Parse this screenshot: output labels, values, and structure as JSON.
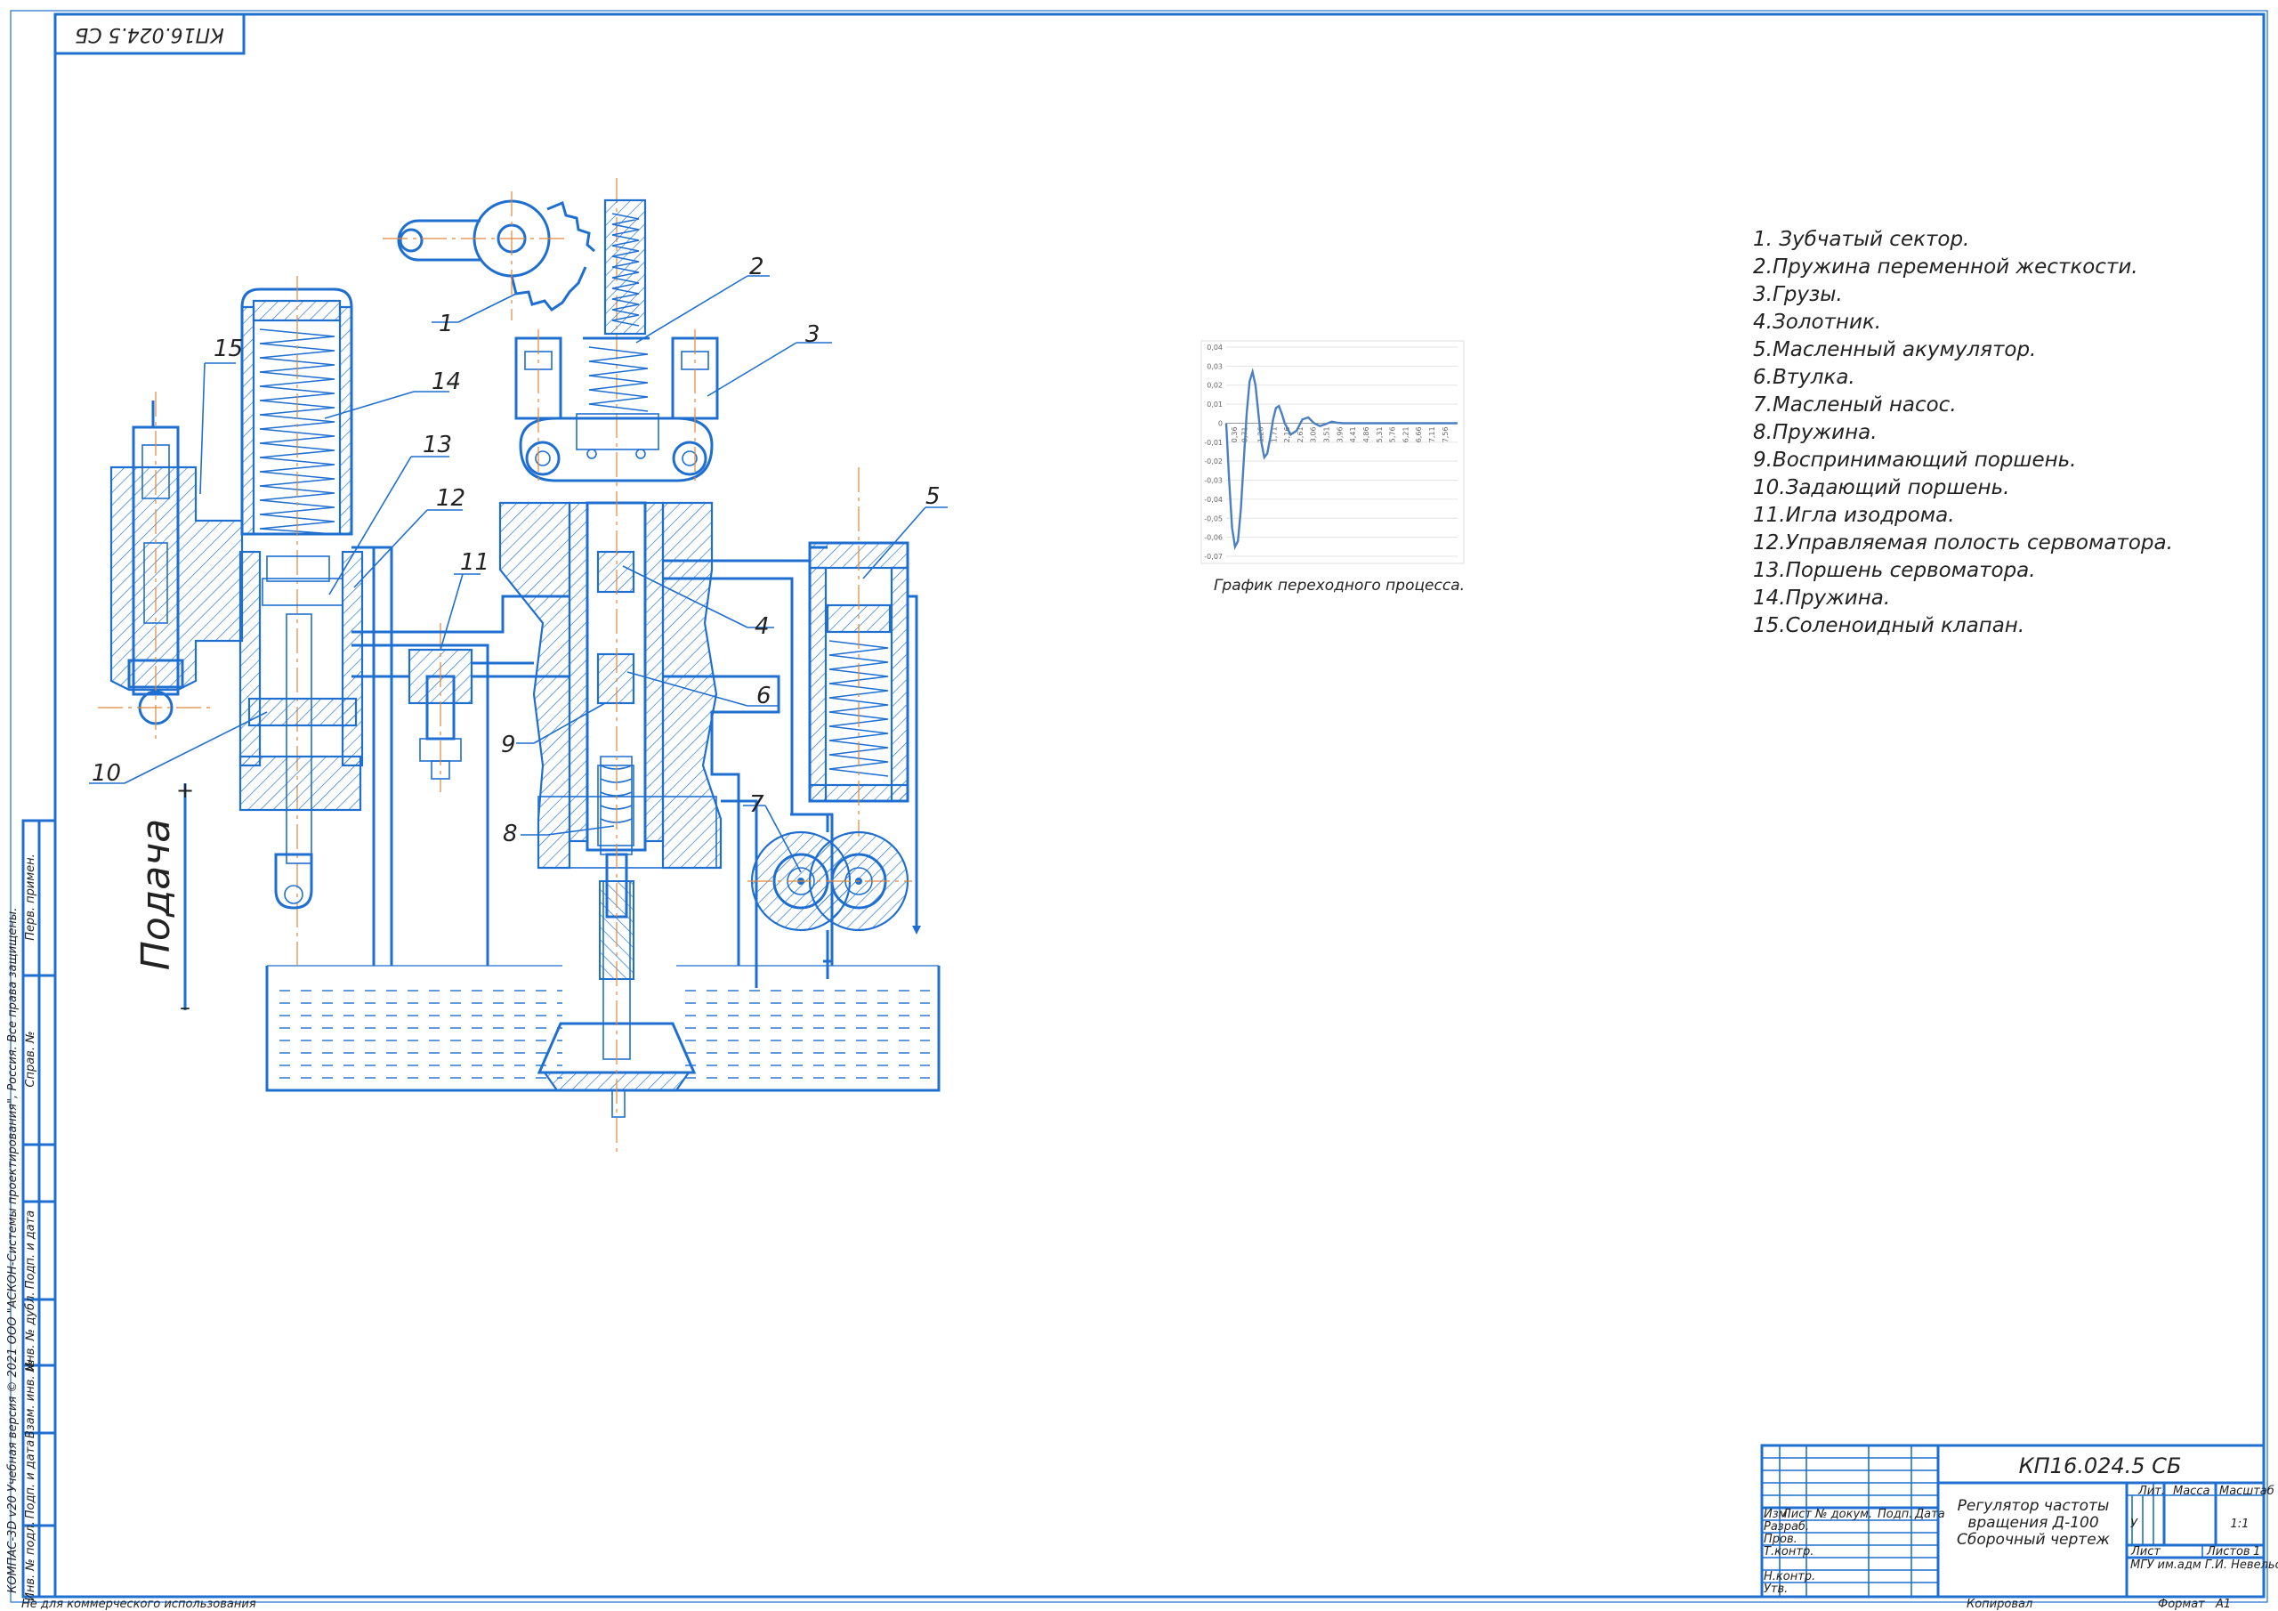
{
  "sheet": {
    "stamp_code_rotated": "КП16.024.5 СБ",
    "footer_left": "Не для коммерческого использования",
    "footer_copied": "Копировал",
    "footer_format_label": "Формат",
    "footer_format_value": "А1",
    "license_text": "КОМПАС-3D v20 Учебная версия © 2021 ООО \"АСКОН-Системы проектирования\", Россия. Все права защищены.",
    "side_labels": [
      "Перв. примен.",
      "Справ. №",
      "Подп. и дата",
      "Инв. № дубл.",
      "Взам. инв. №",
      "Подп. и дата",
      "Инв. № подл."
    ]
  },
  "drawing": {
    "supply_label": "Подача",
    "plus_sign": "+",
    "minus_sign": "–",
    "callouts": [
      "1",
      "2",
      "3",
      "4",
      "5",
      "6",
      "7",
      "8",
      "9",
      "10",
      "11",
      "12",
      "13",
      "14",
      "15"
    ]
  },
  "parts_list": [
    "1. Зубчатый сектор.",
    "2.Пружина переменной жесткости.",
    "3.Грузы.",
    "4.Золотник.",
    "5.Масленный акумулятор.",
    "6.Втулка.",
    "7.Масленый насос.",
    "8.Пружина.",
    "9.Воспринимающий поршень.",
    "10.Задающий поршень.",
    "11.Игла изодрома.",
    "12.Управляемая полость сервоматора.",
    "13.Поршень сервоматора.",
    "14.Пружина.",
    "15.Соленоидный клапан."
  ],
  "chart_data": {
    "type": "line",
    "title": "График переходного процесса.",
    "y_ticks": [
      "0,04",
      "0,03",
      "0,02",
      "0,01",
      "0",
      "-0,01",
      "-0,02",
      "-0,03",
      "-0,04",
      "-0,05",
      "-0,06",
      "-0,07"
    ],
    "x_ticks": [
      "0,36",
      "0,71",
      "1,26",
      "1,71",
      "2,16",
      "2,61",
      "3,06",
      "3,51",
      "3,96",
      "4,41",
      "4,86",
      "5,31",
      "5,76",
      "6,21",
      "6,66",
      "7,11",
      "7,56"
    ],
    "ylim": [
      -0.07,
      0.04
    ],
    "xlim": [
      0,
      7.9
    ],
    "grid": true,
    "series": [
      {
        "x": [
          0,
          0.1,
          0.2,
          0.3,
          0.4,
          0.5,
          0.6,
          0.7,
          0.8,
          0.9,
          1.0,
          1.1,
          1.2,
          1.3,
          1.4,
          1.5,
          1.6,
          1.7,
          1.8,
          1.9,
          2.0,
          2.2,
          2.4,
          2.6,
          2.8,
          3.0,
          3.2,
          3.4,
          3.6,
          3.8,
          4.0,
          4.5,
          5.0,
          5.5,
          6.0,
          6.5,
          7.0,
          7.5,
          7.9
        ],
        "y": [
          0,
          -0.03,
          -0.055,
          -0.065,
          -0.062,
          -0.045,
          -0.02,
          0.005,
          0.022,
          0.027,
          0.02,
          0.005,
          -0.01,
          -0.018,
          -0.016,
          -0.008,
          0.002,
          0.008,
          0.009,
          0.005,
          0.0,
          -0.006,
          -0.004,
          0.002,
          0.003,
          0.0,
          -0.0015,
          -0.0005,
          0.0008,
          0.0002,
          0,
          0,
          0,
          0,
          0,
          0,
          0,
          0,
          0
        ]
      }
    ]
  },
  "title_block": {
    "designation": "КП16.024.5 СБ",
    "name_line1": "Регулятор частоты",
    "name_line2": "вращения Д-100",
    "name_line3": "Сборочный чертеж",
    "col_lit": "Лит.",
    "col_mass": "Масса",
    "col_scale": "Масштаб",
    "lit_value": "У",
    "scale_value": "1:1",
    "sheet_label": "Лист",
    "sheets_label": "Листов",
    "sheets_value": "1",
    "org": "МГУ им.адм Г.И. Невельского",
    "hdr_izm": "Изм.",
    "hdr_list": "Лист",
    "hdr_doc": "№ докум.",
    "hdr_sign": "Подп.",
    "hdr_date": "Дата",
    "row_razrab": "Разраб.",
    "row_prov": "Пров.",
    "row_tkontr": "Т.контр.",
    "row_nkontr": "Н.контр.",
    "row_utv": "Утв."
  },
  "colors": {
    "line": "#1f6fd1",
    "axis": "#e0883a",
    "text": "#222222",
    "graph": "#4a7fc1"
  }
}
